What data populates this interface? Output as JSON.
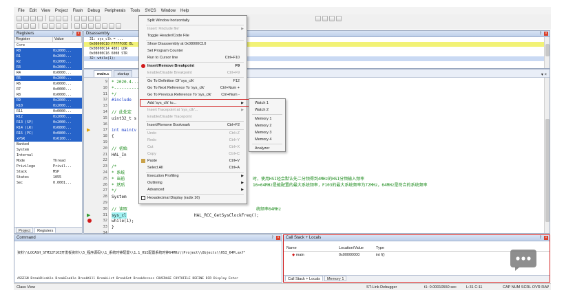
{
  "menubar": [
    "File",
    "Edit",
    "View",
    "Project",
    "Flash",
    "Debug",
    "Peripherals",
    "Tools",
    "SVCS",
    "Window",
    "Help"
  ],
  "registers": {
    "title": "Registers",
    "col_register": "Register",
    "col_value": "Value",
    "rows": [
      {
        "name": "Core",
        "value": "",
        "sel": false
      },
      {
        "name": "  R0",
        "value": "0x2000...",
        "sel": true
      },
      {
        "name": "  R1",
        "value": "0x2000...",
        "sel": true
      },
      {
        "name": "  R2",
        "value": "0x2000...",
        "sel": true
      },
      {
        "name": "  R3",
        "value": "0x2000...",
        "sel": true
      },
      {
        "name": "  R4",
        "value": "0x0000...",
        "sel": false
      },
      {
        "name": "  R5",
        "value": "0x2000...",
        "sel": true
      },
      {
        "name": "  R6",
        "value": "0x0000...",
        "sel": false
      },
      {
        "name": "  R7",
        "value": "0x0000...",
        "sel": false
      },
      {
        "name": "  R8",
        "value": "0x0000...",
        "sel": false
      },
      {
        "name": "  R9",
        "value": "0x2000...",
        "sel": true
      },
      {
        "name": "  R10",
        "value": "0x2000...",
        "sel": true
      },
      {
        "name": "  R11",
        "value": "0x0000...",
        "sel": false
      },
      {
        "name": "  R12",
        "value": "0x2000...",
        "sel": true
      },
      {
        "name": "  R13 (SP)",
        "value": "0x2000...",
        "sel": true
      },
      {
        "name": "  R14 (LR)",
        "value": "0x0800...",
        "sel": true
      },
      {
        "name": "  R15 (PC)",
        "value": "0x0800...",
        "sel": true
      },
      {
        "name": "  xPSR",
        "value": "0x6100...",
        "sel": true
      },
      {
        "name": "Banked",
        "value": "",
        "sel": false
      },
      {
        "name": "System",
        "value": "",
        "sel": false
      },
      {
        "name": "Internal",
        "value": "",
        "sel": false
      },
      {
        "name": "    Mode",
        "value": "Thread",
        "sel": false
      },
      {
        "name": "    Privilege",
        "value": "Privil...",
        "sel": false
      },
      {
        "name": "    Stack",
        "value": "MSP",
        "sel": false
      },
      {
        "name": "    States",
        "value": "1055",
        "sel": false
      },
      {
        "name": "    Sec",
        "value": "0.0001...",
        "sel": false
      }
    ],
    "tabs": [
      "Project",
      "Registers"
    ]
  },
  "disassembly": {
    "title": "Disassembly",
    "lines": [
      "31:    sys_clk = ...",
      "0x08000C10 F7FFFC0E  BL",
      "0x08000C14 4801      LDR",
      "0x08000C16 6008      STR",
      "32:    while(1);",
      "0x08000C18 E7FE      B"
    ]
  },
  "editor": {
    "tabs": [
      "main.c",
      "startup"
    ],
    "lines": [
      {
        "n": "9",
        "t": " * 2020.4..."
      },
      {
        "n": "10",
        "t": " *-----------"
      },
      {
        "n": "11",
        "t": " */"
      },
      {
        "n": "12",
        "t": "#include"
      },
      {
        "n": "13",
        "t": ""
      },
      {
        "n": "14",
        "t": "// 此处定"
      },
      {
        "n": "15",
        "t": "uint32_t s"
      },
      {
        "n": "16",
        "t": ""
      },
      {
        "n": "17",
        "t": "int main(v"
      },
      {
        "n": "18",
        "t": "{"
      },
      {
        "n": "19",
        "t": ""
      },
      {
        "n": "20",
        "t": "    // 初始"
      },
      {
        "n": "21",
        "t": "    HAL_In"
      },
      {
        "n": "22",
        "t": ""
      },
      {
        "n": "23",
        "t": "    /*"
      },
      {
        "n": "24",
        "t": "     * 系统"
      },
      {
        "n": "25",
        "t": "     * 当前"
      },
      {
        "n": "26",
        "t": "     * 然后"
      },
      {
        "n": "27",
        "t": "     */"
      },
      {
        "n": "28",
        "t": "    System"
      },
      {
        "n": "29",
        "t": ""
      },
      {
        "n": "30",
        "t": "    // 读取"
      },
      {
        "n": "31",
        "t": "    sys_cl"
      },
      {
        "n": "32",
        "t": "    while(1);"
      },
      {
        "n": "33",
        "t": "}"
      },
      {
        "n": "34",
        "t": ""
      }
    ],
    "comment_25_tail": "时，使用HSI经会默认先二分频得到4MHz的HSI分频输入频率",
    "comment_26_tail": "16=64MHz是能配置的最大系统频率，F103的最大系统频率为72MHz，64MHz是符合的系统频率",
    "comment_30_tail": "统频率64MHz",
    "line31_tail": "     HAL_RCC_GetSysClockFreq();"
  },
  "context_menu": {
    "items": [
      {
        "label": "Split Window horizontally",
        "sc": "",
        "state": "normal"
      },
      {
        "label": "Insert '#include file'",
        "sc": "",
        "state": "dis",
        "arrow": true
      },
      {
        "label": "Toggle Header/Code File",
        "sc": "",
        "state": "normal"
      },
      {
        "label": "Show Disassembly at 0x08000C10",
        "sc": "",
        "state": "normal"
      },
      {
        "label": "Set Program Counter",
        "sc": "",
        "state": "normal"
      },
      {
        "label": "Run to Cursor line",
        "sc": "Ctrl+F10",
        "state": "normal"
      },
      {
        "label": "Insert/Remove Breakpoint",
        "sc": "F9",
        "state": "bold"
      },
      {
        "label": "Enable/Disable Breakpoint",
        "sc": "Ctrl+F9",
        "state": "dis"
      },
      {
        "label": "Go To Definition Of 'sys_clk'",
        "sc": "F12",
        "state": "normal"
      },
      {
        "label": "Go To Next Reference To 'sys_clk'",
        "sc": "Ctrl+Num +",
        "state": "normal"
      },
      {
        "label": "Go To Previous Reference To 'sys_clk'",
        "sc": "Ctrl+Num -",
        "state": "normal"
      },
      {
        "label": "Add 'sys_clk' to...",
        "sc": "",
        "state": "normal",
        "arrow": true
      },
      {
        "label": "Insert Tracepoint at 'sys_clk'...",
        "sc": "",
        "state": "dis",
        "arrow": true
      },
      {
        "label": "Enable/Disable Tracepoint",
        "sc": "",
        "state": "dis"
      },
      {
        "label": "Insert/Remove Bookmark",
        "sc": "Ctrl+F2",
        "state": "normal"
      },
      {
        "label": "Undo",
        "sc": "Ctrl+Z",
        "state": "dis"
      },
      {
        "label": "Redo",
        "sc": "Ctrl+Y",
        "state": "dis"
      },
      {
        "label": "Cut",
        "sc": "Ctrl+X",
        "state": "dis"
      },
      {
        "label": "Copy",
        "sc": "Ctrl+C",
        "state": "dis"
      },
      {
        "label": "Paste",
        "sc": "Ctrl+V",
        "state": "normal"
      },
      {
        "label": "Select All",
        "sc": "Ctrl+A",
        "state": "normal"
      },
      {
        "label": "Execution Profiling",
        "sc": "",
        "state": "normal",
        "arrow": true
      },
      {
        "label": "Outlining",
        "sc": "",
        "state": "normal",
        "arrow": true
      },
      {
        "label": "Advanced",
        "sc": "",
        "state": "normal",
        "arrow": true
      },
      {
        "label": "Hexadecimal Display (radix 16)",
        "sc": "",
        "state": "normal"
      }
    ]
  },
  "submenu": [
    "Watch 1",
    "Watch 2",
    "Memory 1",
    "Memory 2",
    "Memory 3",
    "Memory 4",
    "Analyzer"
  ],
  "command": {
    "title": "Command",
    "line": "资料\\\\LOCASH_STM32F103开发板资料\\\\5_程序源码\\\\1_系统时钟配置\\\\1.1_HSI配置系统时钟64MHz\\\\Project\\\\Objects\\\\HSI_64M.axf\"",
    "hint": "ASSIGN BreakDisable BreakEnable BreakKill BreakList BreakSet BreakAccess COVERAGE COVTOFILE DEFINE DIR Display Enter"
  },
  "callstack": {
    "title": "Call Stack + Locals",
    "cols": [
      "Name",
      "Location/Value",
      "Type"
    ],
    "row": {
      "name": "main",
      "value": "0x00000000",
      "type": "int f()"
    },
    "tabs": [
      "Call Stack + Locals",
      "Memory 1"
    ]
  },
  "status": {
    "left": "Class View",
    "debugger": "ST-Link Debugger",
    "time": "t1: 0.00010550 sec",
    "pos": "L:31 C:11",
    "caps": "CAP  NUM  SCRL  OVR  R/W"
  },
  "colors": {
    "accent": "#2663c9",
    "highlight_red": "#d11a1a"
  }
}
